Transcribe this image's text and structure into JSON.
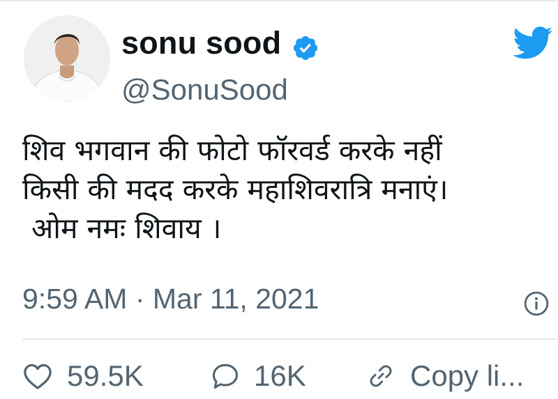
{
  "tweet": {
    "author_name": "sonu sood",
    "handle": "@SonuSood",
    "text_lines": [
      "शिव भगवान की फोटो फॉरवर्ड करके नहीं",
      "किसी की मदद करके महाशिवरात्रि मनाएं।",
      " ओम नमः शिवाय ।"
    ],
    "timestamp": "9:59 AM · Mar 11, 2021"
  },
  "actions": {
    "likes": "59.5K",
    "replies": "16K",
    "copy_link": "Copy li..."
  },
  "icons": {
    "verified": "verified-badge-icon",
    "brand": "twitter-bird-icon",
    "info": "info-icon",
    "like": "heart-icon",
    "reply": "reply-bubble-icon",
    "link": "link-icon"
  },
  "colors": {
    "accent": "#1d9bf0",
    "secondary_text": "#536471",
    "primary_text": "#0f1419"
  }
}
